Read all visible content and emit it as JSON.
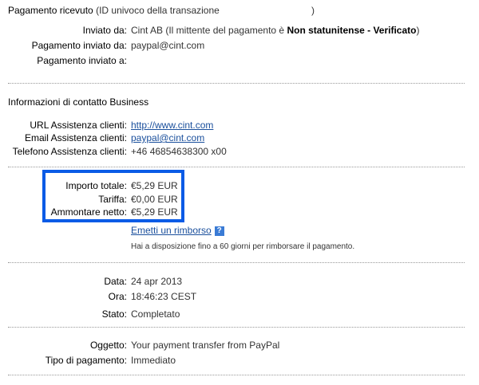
{
  "header": {
    "title": "Pagamento ricevuto",
    "id_label": "(ID univoco della transazione",
    "id_close": ")"
  },
  "sender": {
    "inviato_da_label": "Inviato da:",
    "inviato_da_value_prefix": "Cint AB (Il mittente del pagamento è ",
    "inviato_da_value_bold": "Non statunitense - Verificato",
    "inviato_da_value_suffix": ")",
    "pag_inviato_da_label": "Pagamento inviato da:",
    "pag_inviato_da_value": "paypal@cint.com",
    "pag_inviato_a_label": "Pagamento inviato a:"
  },
  "contact": {
    "title": "Informazioni di contatto Business",
    "url_label": "URL Assistenza clienti:",
    "url_value": "http://www.cint.com",
    "email_label": "Email Assistenza clienti:",
    "email_value": "paypal@cint.com",
    "phone_label": "Telefono Assistenza clienti:",
    "phone_value": "+46 46854638300 x00"
  },
  "amounts": {
    "total_label": "Importo totale:",
    "total_value": "€5,29 EUR",
    "fee_label": "Tariffa:",
    "fee_value": "€0,00 EUR",
    "net_label": "Ammontare netto:",
    "net_value": "€5,29 EUR",
    "refund_link": "Emetti un rimborso",
    "help_icon": "?",
    "refund_note": "Hai a disposizione fino a 60 giorni per rimborsare il pagamento."
  },
  "details": {
    "date_label": "Data:",
    "date_value": "24 apr 2013",
    "time_label": "Ora:",
    "time_value": "18:46:23 CEST",
    "status_label": "Stato:",
    "status_value": "Completato"
  },
  "payment": {
    "subject_label": "Oggetto:",
    "subject_value": "Your payment transfer from PayPal",
    "type_label": "Tipo di pagamento:",
    "type_value": "Immediato"
  },
  "colors": {
    "highlight_box": "#0a5be6",
    "link": "#1a4f9c"
  }
}
